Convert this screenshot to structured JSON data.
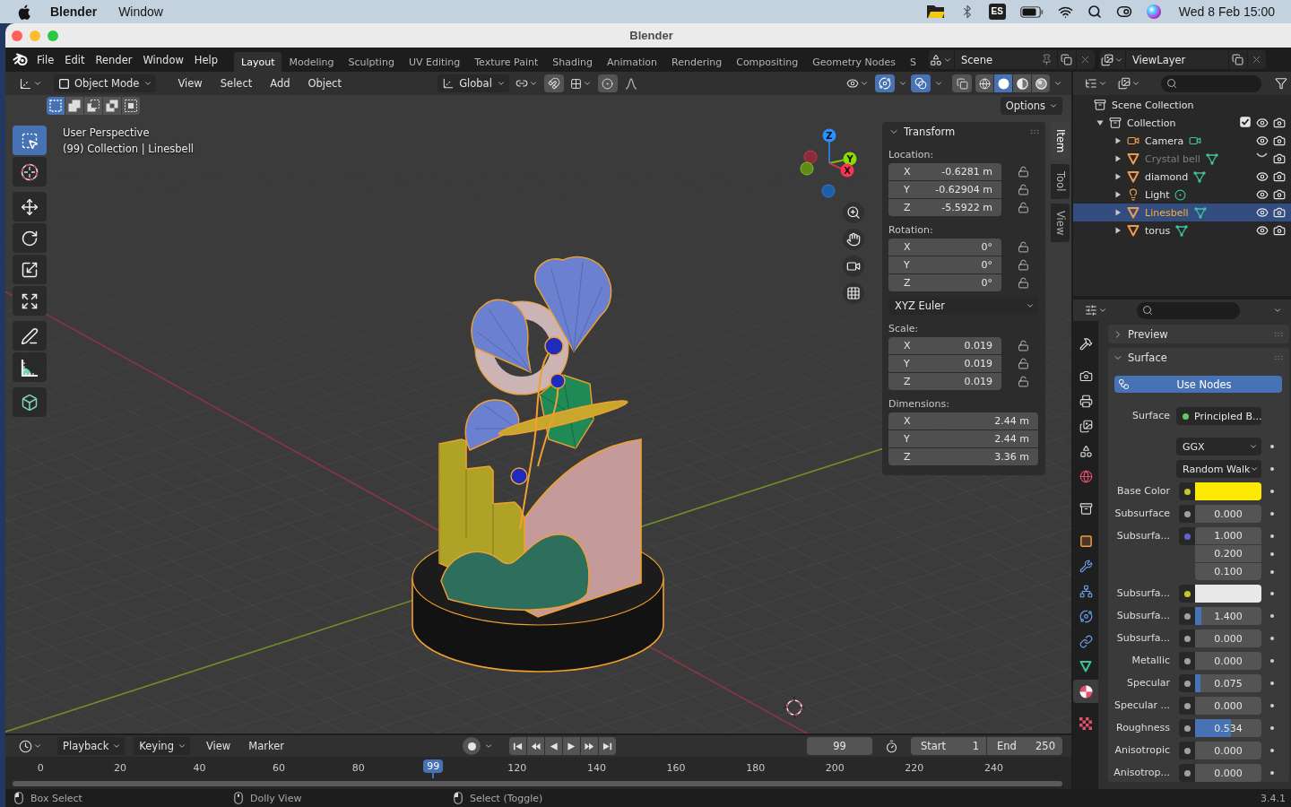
{
  "menu_bar": {
    "app": "Blender",
    "menus": [
      "Window"
    ],
    "input_source": "ES",
    "clock": "Wed 8 Feb 15:00"
  },
  "window": {
    "title": "Blender"
  },
  "top_bar": {
    "menus": [
      "File",
      "Edit",
      "Render",
      "Window",
      "Help"
    ],
    "workspaces": [
      {
        "label": "Layout",
        "selected": true
      },
      {
        "label": "Modeling",
        "selected": false
      },
      {
        "label": "Sculpting",
        "selected": false
      },
      {
        "label": "UV Editing",
        "selected": false
      },
      {
        "label": "Texture Paint",
        "selected": false
      },
      {
        "label": "Shading",
        "selected": false
      },
      {
        "label": "Animation",
        "selected": false
      },
      {
        "label": "Rendering",
        "selected": false
      },
      {
        "label": "Compositing",
        "selected": false
      },
      {
        "label": "Geometry Nodes",
        "selected": false
      },
      {
        "label": "S",
        "selected": false
      }
    ],
    "scene": "Scene",
    "view_layer": "ViewLayer"
  },
  "viewport": {
    "header": {
      "mode": "Object Mode",
      "menus": [
        "View",
        "Select",
        "Add",
        "Object"
      ],
      "orientation": "Global",
      "snap": false,
      "proportional_editing": false,
      "gizmos": true,
      "overlays": true,
      "xray": false,
      "shading": [
        {
          "kind": "wireframe",
          "selected": false
        },
        {
          "kind": "solid",
          "selected": true
        },
        {
          "kind": "material",
          "selected": false
        },
        {
          "kind": "rendered",
          "selected": false
        }
      ]
    },
    "select_modes": [
      {
        "kind": "set",
        "selected": true
      },
      {
        "kind": "extend",
        "selected": false
      },
      {
        "kind": "subtract",
        "selected": false
      },
      {
        "kind": "difference",
        "selected": false
      },
      {
        "kind": "intersect",
        "selected": false
      }
    ],
    "options": "Options",
    "tool_groups": [
      {
        "tools": [
          {
            "kind": "select",
            "selected": true
          },
          {
            "kind": "cursor",
            "selected": false
          }
        ]
      },
      {
        "tools": [
          {
            "kind": "move",
            "selected": false
          },
          {
            "kind": "rotate",
            "selected": false
          },
          {
            "kind": "scale",
            "selected": false
          },
          {
            "kind": "transform",
            "selected": false
          }
        ]
      },
      {
        "tools": [
          {
            "kind": "annotate",
            "selected": false
          },
          {
            "kind": "measure",
            "selected": false
          }
        ]
      },
      {
        "tools": [
          {
            "kind": "add",
            "selected": false
          }
        ]
      }
    ],
    "info": [
      "User Perspective",
      "(99) Collection | Linesbell"
    ],
    "gizmo": {
      "z": "Z",
      "y": "Y",
      "x": "X"
    }
  },
  "sidebar": {
    "tabs": [
      {
        "label": "Item",
        "selected": true
      },
      {
        "label": "Tool",
        "selected": false
      },
      {
        "label": "View",
        "selected": false
      }
    ],
    "panel": {
      "title": "Transform",
      "expanded": true,
      "groups": [
        {
          "label": "Location:",
          "lockable": true,
          "fields": [
            {
              "axis": "X",
              "value": "-0.6281 m",
              "locked": false
            },
            {
              "axis": "Y",
              "value": "-0.62904 m",
              "locked": false
            },
            {
              "axis": "Z",
              "value": "-5.5922 m",
              "locked": false
            }
          ]
        },
        {
          "label": "Rotation:",
          "lockable": true,
          "fields": [
            {
              "axis": "X",
              "value": "0°",
              "locked": false
            },
            {
              "axis": "Y",
              "value": "0°",
              "locked": false
            },
            {
              "axis": "Z",
              "value": "0°",
              "locked": false
            }
          ],
          "mode": "XYZ Euler"
        },
        {
          "label": "Scale:",
          "lockable": true,
          "fields": [
            {
              "axis": "X",
              "value": "0.019",
              "locked": false
            },
            {
              "axis": "Y",
              "value": "0.019",
              "locked": false
            },
            {
              "axis": "Z",
              "value": "0.019",
              "locked": false
            }
          ]
        },
        {
          "label": "Dimensions:",
          "lockable": false,
          "fields": [
            {
              "axis": "X",
              "value": "2.44 m"
            },
            {
              "axis": "Y",
              "value": "2.44 m"
            },
            {
              "axis": "Z",
              "value": "3.36 m"
            }
          ]
        }
      ]
    }
  },
  "outliner": {
    "root": "Scene Collection",
    "collections": [
      {
        "label": "Collection",
        "kind": "collection",
        "expanded": true,
        "included": true,
        "visible": true,
        "children": [
          {
            "label": "Camera",
            "kind": "camera",
            "expanded": false,
            "selected": false,
            "visible": true
          },
          {
            "label": "Crystal bell",
            "kind": "mesh",
            "expanded": false,
            "selected": false,
            "visible": false
          },
          {
            "label": "diamond",
            "kind": "mesh",
            "expanded": false,
            "selected": false,
            "visible": true
          },
          {
            "label": "Light",
            "kind": "light",
            "expanded": false,
            "selected": false,
            "visible": true
          },
          {
            "label": "Linesbell",
            "kind": "mesh",
            "expanded": false,
            "selected": true,
            "visible": true
          },
          {
            "label": "torus",
            "kind": "mesh",
            "expanded": false,
            "selected": false,
            "visible": true
          }
        ]
      }
    ]
  },
  "properties": {
    "tab_groups": [
      {
        "tabs": [
          {
            "kind": "tool",
            "selected": false
          }
        ]
      },
      {
        "tabs": [
          {
            "kind": "render",
            "selected": false
          },
          {
            "kind": "output",
            "selected": false
          },
          {
            "kind": "viewlayer",
            "selected": false
          },
          {
            "kind": "scene",
            "selected": false
          },
          {
            "kind": "world",
            "selected": false
          }
        ]
      },
      {
        "tabs": [
          {
            "kind": "collection",
            "selected": false
          }
        ]
      },
      {
        "tabs": [
          {
            "kind": "object",
            "selected": false
          },
          {
            "kind": "modifiers",
            "selected": false
          },
          {
            "kind": "particles",
            "selected": false
          },
          {
            "kind": "physics",
            "selected": false
          },
          {
            "kind": "constraints",
            "selected": false
          },
          {
            "kind": "data",
            "selected": false
          },
          {
            "kind": "material",
            "selected": true
          }
        ]
      },
      {
        "tabs": [
          {
            "kind": "texture",
            "selected": false
          }
        ]
      }
    ],
    "panels": [
      {
        "title": "Preview",
        "expanded": false
      },
      {
        "title": "Surface",
        "expanded": true,
        "use_nodes": "Use Nodes",
        "shader_label": "Surface",
        "shader": "Principled B...",
        "distribution": "GGX",
        "subsurface_method": "Random Walk",
        "inputs": [
          {
            "kind": "color",
            "label": "Base Color",
            "socket": {
              "color": "#c7c729"
            },
            "color": "#fde800"
          },
          {
            "kind": "float",
            "label": "Subsurface",
            "socket": {
              "color": "#a1a1a1"
            },
            "value": "0.000"
          },
          {
            "kind": "vector",
            "label": "Subsurfa...",
            "socket": {
              "color": "#6363c7"
            },
            "values": [
              "1.000",
              "0.200",
              "0.100"
            ]
          },
          {
            "kind": "color",
            "label": "Subsurfa...",
            "socket": {
              "color": "#c7c729"
            },
            "color": "#e8e8e8"
          },
          {
            "kind": "float",
            "label": "Subsurfa...",
            "socket": {
              "color": "#a1a1a1"
            },
            "value": "1.400",
            "level": 0.09
          },
          {
            "kind": "float",
            "label": "Subsurfa...",
            "socket": {
              "color": "#a1a1a1"
            },
            "value": "0.000"
          },
          {
            "kind": "float",
            "label": "Metallic",
            "socket": {
              "color": "#a1a1a1"
            },
            "value": "0.000"
          },
          {
            "kind": "float",
            "label": "Specular",
            "socket": {
              "color": "#a1a1a1"
            },
            "value": "0.075",
            "level": 0.075
          },
          {
            "kind": "float",
            "label": "Specular ...",
            "socket": {
              "color": "#a1a1a1"
            },
            "value": "0.000"
          },
          {
            "kind": "float",
            "label": "Roughness",
            "socket": {
              "color": "#a1a1a1"
            },
            "value": "0.534",
            "level": 0.534
          },
          {
            "kind": "float",
            "label": "Anisotropic",
            "socket": {
              "color": "#a1a1a1"
            },
            "value": "0.000"
          },
          {
            "kind": "float",
            "label": "Anisotrop...",
            "socket": {
              "color": "#a1a1a1"
            },
            "value": "0.000"
          }
        ]
      }
    ]
  },
  "timeline": {
    "menus": [
      {
        "label": "Playback",
        "dropdown": true
      },
      {
        "label": "Keying",
        "dropdown": true
      },
      {
        "label": "View",
        "dropdown": false
      },
      {
        "label": "Marker",
        "dropdown": false
      }
    ],
    "frame": "99",
    "start_label": "Start",
    "start": "1",
    "end_label": "End",
    "end": "250",
    "ticks_before": [
      "0",
      "20",
      "40",
      "60",
      "80"
    ],
    "playhead": "99",
    "ticks_after": [
      "120",
      "140",
      "160",
      "180",
      "200",
      "220",
      "240"
    ]
  },
  "status_bar": {
    "hints": [
      {
        "kind": "left",
        "label": "Box Select"
      },
      {
        "kind": "middle",
        "label": "Dolly View"
      },
      {
        "kind": "left",
        "label": "Select (Toggle)"
      }
    ],
    "version": "3.4.1"
  }
}
